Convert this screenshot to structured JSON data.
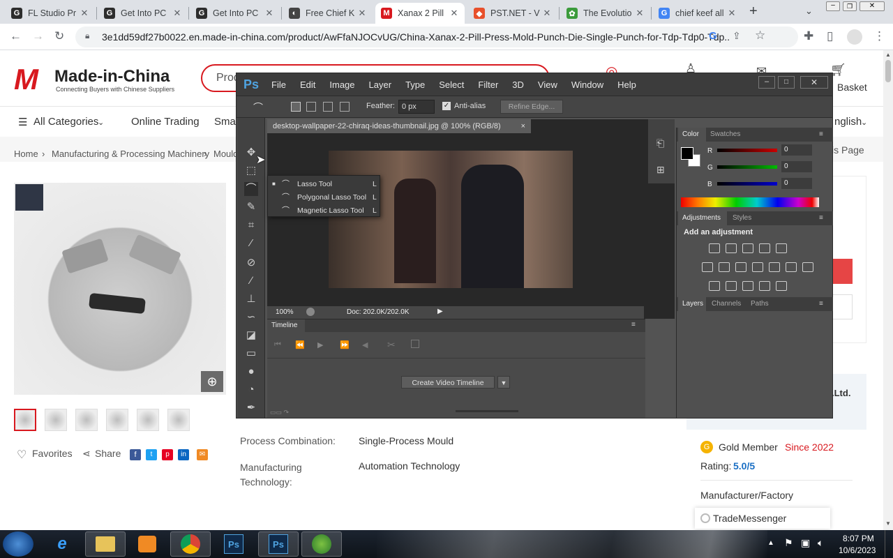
{
  "browser": {
    "tabs": [
      {
        "title": "FL Studio Pr",
        "favicon": "G",
        "color": "#2d2d2d"
      },
      {
        "title": "Get Into PC",
        "favicon": "G",
        "color": "#2d2d2d"
      },
      {
        "title": "Get Into PC",
        "favicon": "G",
        "color": "#2d2d2d"
      },
      {
        "title": "Free Chief K",
        "favicon": "◐",
        "color": "#444"
      },
      {
        "title": "Xanax 2 Pill",
        "favicon": "M",
        "color": "#d8191f"
      },
      {
        "title": "PST.NET - V",
        "favicon": "◆",
        "color": "#e8502b"
      },
      {
        "title": "The Evolutio",
        "favicon": "✿",
        "color": "#3b9b3b"
      },
      {
        "title": "chief keef all",
        "favicon": "G",
        "color": "#4285f4"
      }
    ],
    "new_tab": "+",
    "url": "3e1dd59df27b0022.en.made-in-china.com/product/AwFfaNJOCvUG/China-Xanax-2-Pill-Press-Mold-Punch-Die-Single-Punch-for-Tdp-Tdp0-Tdp..."
  },
  "site": {
    "logo_text": "Made-in-China",
    "logo_tagline": "Connecting Buyers with Chinese Suppliers",
    "search_placeholder": "Prod",
    "basket": "Basket",
    "nav": {
      "all_categories": "All Categories",
      "online_trading": "Online Trading",
      "smart": "Smar",
      "language": "nglish"
    },
    "breadcrumb": [
      "Home",
      "Manufacturing & Processing Machinery",
      "Mould"
    ],
    "this_page": "is Page",
    "favorites": "Favorites",
    "share": "Share",
    "attributes": [
      {
        "label": "Process Combination:",
        "value": "Single-Process Mould"
      },
      {
        "label": "Manufacturing Technology:",
        "value": "Automation Technology"
      }
    ],
    "supplier": {
      "ltd": ".Ltd.",
      "gold_member": "Gold Member",
      "since": "Since 2022",
      "rating_label": "Rating:",
      "rating": "5.0/5",
      "type": "Manufacturer/Factory"
    },
    "trademessenger": "TradeMessenger"
  },
  "photoshop": {
    "logo": "Ps",
    "menus": [
      "File",
      "Edit",
      "Image",
      "Layer",
      "Type",
      "Select",
      "Filter",
      "3D",
      "View",
      "Window",
      "Help"
    ],
    "feather_label": "Feather:",
    "feather_value": "0 px",
    "antialias": "Anti-alias",
    "refine_edge": "Refine Edge...",
    "doc_title": "desktop-wallpaper-22-chiraq-ideas-thumbnail.jpg @ 100% (RGB/8)",
    "zoom": "100%",
    "doc_size": "Doc: 202.0K/202.0K",
    "flyout": [
      {
        "name": "Lasso Tool",
        "key": "L"
      },
      {
        "name": "Polygonal Lasso Tool",
        "key": "L"
      },
      {
        "name": "Magnetic Lasso Tool",
        "key": "L"
      }
    ],
    "timeline_tab": "Timeline",
    "create_video_timeline": "Create Video Timeline",
    "panel_tabs_top": [
      "Color",
      "Swatches"
    ],
    "color_channels": [
      {
        "label": "R",
        "value": "0"
      },
      {
        "label": "G",
        "value": "0"
      },
      {
        "label": "B",
        "value": "0"
      }
    ],
    "panel_tabs_mid": [
      "Adjustments",
      "Styles"
    ],
    "add_adjustment": "Add an adjustment",
    "panel_tabs_bottom": [
      "Layers",
      "Channels",
      "Paths"
    ]
  },
  "taskbar": {
    "time": "8:07 PM",
    "date": "10/6/2023"
  }
}
